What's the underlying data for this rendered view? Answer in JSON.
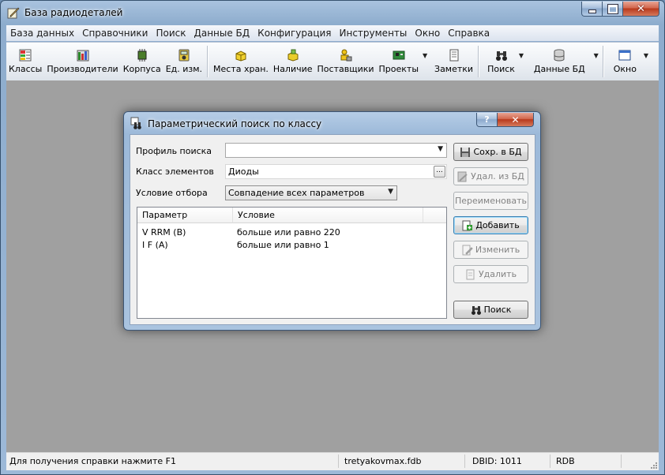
{
  "window": {
    "title": "База радиодеталей"
  },
  "menu": [
    "База данных",
    "Справочники",
    "Поиск",
    "Данные БД",
    "Конфигурация",
    "Инструменты",
    "Окно",
    "Справка"
  ],
  "toolbar": {
    "classes": "Классы",
    "manufacturers": "Производители",
    "packages": "Корпуса",
    "units": "Ед. изм.",
    "storage": "Места хран.",
    "availability": "Наличие",
    "suppliers": "Поставщики",
    "projects": "Проекты",
    "notes": "Заметки",
    "search": "Поиск",
    "db_data": "Данные БД",
    "window": "Окно"
  },
  "dialog": {
    "title": "Параметрический поиск по классу",
    "help_glyph": "?",
    "close_glyph": "✕",
    "profile_label": "Профиль поиска",
    "profile_value": "",
    "class_label": "Класс элементов",
    "class_value": "Диоды",
    "ellipsis": "...",
    "condition_label": "Условие отбора",
    "condition_value": "Совпадение всех параметров",
    "columns": [
      "Параметр",
      "Условие"
    ],
    "rows": [
      {
        "param": "V RRM (В)",
        "cond": "больше или равно 220"
      },
      {
        "param": "I F (А)",
        "cond": "больше или равно 1"
      }
    ],
    "buttons": {
      "save": "Сохр. в БД",
      "delete": "Удал. из БД",
      "rename": "Переименовать",
      "add": "Добавить",
      "edit": "Изменить",
      "remove": "Удалить",
      "search": "Поиск"
    }
  },
  "status": {
    "hint": "Для получения справки нажмите F1",
    "file": "tretyakovmax.fdb",
    "dbid": "DBID: 1011",
    "type": "RDB"
  }
}
